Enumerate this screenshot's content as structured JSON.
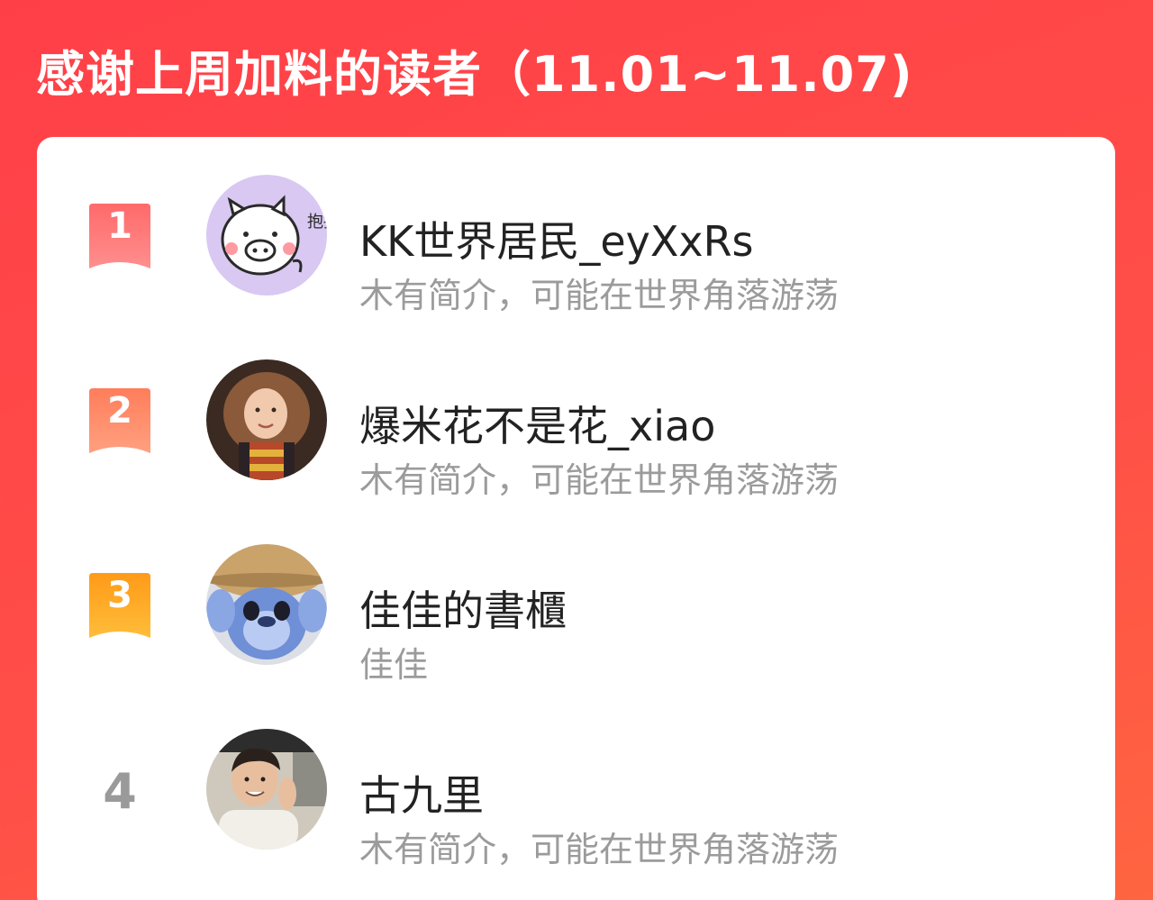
{
  "header": {
    "title": "感谢上周加料的读者（11.01~11.07)"
  },
  "readers": [
    {
      "rank": "1",
      "rank_color": "#ff5a5f",
      "name": "KK世界居民_eyXxRs",
      "bio": "木有简介，可能在世界角落游荡",
      "avatar_icon": "pig-hug-icon"
    },
    {
      "rank": "2",
      "rank_color": "#ff7a5a",
      "name": "爆米花不是花_xiao",
      "bio": "木有简介，可能在世界角落游荡",
      "avatar_icon": "girl-photo-avatar"
    },
    {
      "rank": "3",
      "rank_color": "#ff9a20",
      "name": "佳佳的書櫃",
      "bio": "佳佳",
      "avatar_icon": "plush-toy-avatar"
    },
    {
      "rank": "4",
      "rank_color": "#9a9a9a",
      "name": "古九里",
      "bio": "木有简介，可能在世界角落游荡",
      "avatar_icon": "man-photo-avatar"
    }
  ],
  "avatar_text": {
    "pig_caption": "抱抱"
  }
}
